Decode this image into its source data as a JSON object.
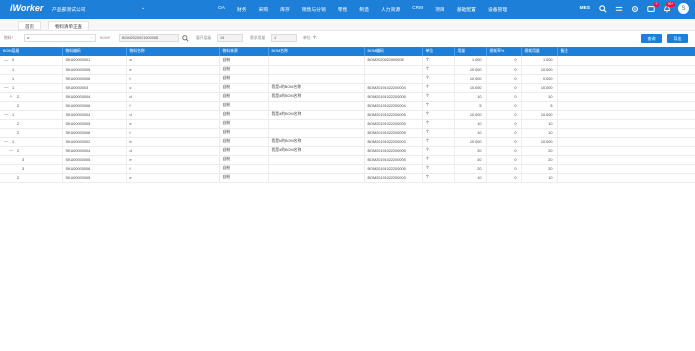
{
  "header": {
    "logo": "iWorker",
    "company": "产品部测试公司",
    "caret": "⌄",
    "nav": [
      "OA",
      "财务",
      "采购",
      "库存",
      "销售与分销",
      "零售",
      "制造",
      "人力资源",
      "CRM",
      "项目",
      "基础配置",
      "设备管理"
    ],
    "user": "MES",
    "msg_badge": "9",
    "bell_badge": "99+",
    "avatar_initial": "S"
  },
  "tabs": [
    "首页",
    "物料清单正查"
  ],
  "filters": {
    "material_label": "物料",
    "material_value": "a",
    "bom_label": "BOM",
    "bom_value": "BOM2020021900008",
    "depth_label": "展开层级",
    "depth_value": "15",
    "demand_label": "需求用量",
    "demand_value": "1",
    "unit_label": "单位",
    "unit_value": "个",
    "query_button": "查询",
    "export_button": "导出"
  },
  "table": {
    "columns": [
      "BOM层级",
      "物料编码",
      "物料名称",
      "物料来源",
      "BOM名称",
      "BOM编码",
      "单位",
      "用量",
      "损耗率%",
      "损耗用量",
      "备注"
    ],
    "rows": [
      {
        "ctrl": "—",
        "level": "0",
        "code": "SKU00000001",
        "name": "a",
        "source": "自制",
        "bom_name": "",
        "bom_code": "BOM2020021900008",
        "unit": "个",
        "qty": "1.000",
        "loss_rate": "0",
        "loss_qty": "1.000",
        "note": ""
      },
      {
        "ctrl": "",
        "level": "1",
        "code": "SKU00000005",
        "name": "e",
        "source": "自制",
        "bom_name": "",
        "bom_code": "",
        "unit": "个",
        "qty": "10.000",
        "loss_rate": "0",
        "loss_qty": "10.000",
        "note": ""
      },
      {
        "ctrl": "",
        "level": "1",
        "code": "SKU00000006",
        "name": "f",
        "source": "自制",
        "bom_name": "",
        "bom_code": "",
        "unit": "个",
        "qty": "10.000",
        "loss_rate": "0",
        "loss_qty": "0.000",
        "note": ""
      },
      {
        "ctrl": "—",
        "level": "1",
        "code": "SKU0000003",
        "name": "c",
        "source": "自制",
        "bom_name": "我是c的BOM名称",
        "bom_code": "BOM20191022200004",
        "unit": "个",
        "qty": "10.000",
        "loss_rate": "0",
        "loss_qty": "10,000",
        "note": ""
      },
      {
        "ctrl": "+",
        "level": "2",
        "code": "SKU00000004",
        "name": "d",
        "source": "自制",
        "bom_name": "我是d的BOM名称",
        "bom_code": "BOM20191022200005",
        "unit": "个",
        "qty": "10",
        "loss_rate": "0",
        "loss_qty": "10",
        "note": ""
      },
      {
        "ctrl": "",
        "level": "2",
        "code": "SKU00000006",
        "name": "f",
        "source": "自制",
        "bom_name": "",
        "bom_code": "BOM20191022200004",
        "unit": "个",
        "qty": "5",
        "loss_rate": "0",
        "loss_qty": "5",
        "note": ""
      },
      {
        "ctrl": "—",
        "level": "1",
        "code": "SKU00000004",
        "name": "d",
        "source": "自制",
        "bom_name": "我是d的BOM名称",
        "bom_code": "BOM20191022200005",
        "unit": "个",
        "qty": "10.000",
        "loss_rate": "0",
        "loss_qty": "10,000",
        "note": ""
      },
      {
        "ctrl": "",
        "level": "2",
        "code": "SKU00000005",
        "name": "e",
        "source": "自制",
        "bom_name": "",
        "bom_code": "BOM20191022200005",
        "unit": "个",
        "qty": "10",
        "loss_rate": "0",
        "loss_qty": "10",
        "note": ""
      },
      {
        "ctrl": "",
        "level": "2",
        "code": "SKU00000006",
        "name": "f",
        "source": "自制",
        "bom_name": "",
        "bom_code": "BOM20191022200005",
        "unit": "个",
        "qty": "10",
        "loss_rate": "0",
        "loss_qty": "10",
        "note": ""
      },
      {
        "ctrl": "—",
        "level": "1",
        "code": "SKU00000002",
        "name": "b",
        "source": "自制",
        "bom_name": "我是b的BOM名称",
        "bom_code": "BOM20191022200003",
        "unit": "个",
        "qty": "10.000",
        "loss_rate": "0",
        "loss_qty": "10.000",
        "note": ""
      },
      {
        "ctrl": "—",
        "level": "2",
        "code": "SKU00000004",
        "name": "d",
        "source": "自制",
        "bom_name": "我是d的BOM名称",
        "bom_code": "BOM20191022200005",
        "unit": "个",
        "qty": "20",
        "loss_rate": "0",
        "loss_qty": "20",
        "note": ""
      },
      {
        "ctrl": "",
        "level": "3",
        "code": "SKU00000005",
        "name": "e",
        "source": "自制",
        "bom_name": "",
        "bom_code": "BOM20191022200005",
        "unit": "个",
        "qty": "20",
        "loss_rate": "0",
        "loss_qty": "20",
        "note": ""
      },
      {
        "ctrl": "",
        "level": "3",
        "code": "SKU00000006",
        "name": "f",
        "source": "自制",
        "bom_name": "",
        "bom_code": "BOM20191022200005",
        "unit": "个",
        "qty": "20",
        "loss_rate": "0",
        "loss_qty": "20",
        "note": ""
      },
      {
        "ctrl": "",
        "level": "2",
        "code": "SKU00000005",
        "name": "e",
        "source": "自制",
        "bom_name": "",
        "bom_code": "BOM20191022200003",
        "unit": "个",
        "qty": "10",
        "loss_rate": "0",
        "loss_qty": "10",
        "note": ""
      }
    ]
  },
  "colors": {
    "brand": "#1e7fd8",
    "badge": "#ff0044"
  }
}
